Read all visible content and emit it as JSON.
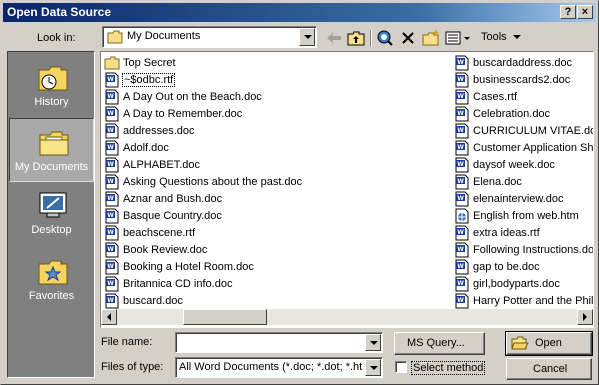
{
  "window": {
    "title": "Open Data Source",
    "help_button": "?",
    "close_button": "×"
  },
  "toolbar": {
    "look_in_label": "Look in:",
    "look_in_value": "My Documents",
    "tools_label": "Tools"
  },
  "places": [
    {
      "label": "History",
      "icon": "history-folder-icon",
      "selected": false
    },
    {
      "label": "My Documents",
      "icon": "my-documents-folder-icon",
      "selected": true
    },
    {
      "label": "Desktop",
      "icon": "desktop-icon",
      "selected": false
    },
    {
      "label": "Favorites",
      "icon": "favorites-folder-icon",
      "selected": false
    }
  ],
  "files": {
    "column1": [
      {
        "name": "Top Secret",
        "icon": "folder"
      },
      {
        "name": "~$odbc.rtf",
        "icon": "word-doc",
        "selected": true
      },
      {
        "name": "A Day Out on the Beach.doc",
        "icon": "word-doc"
      },
      {
        "name": "A Day to Remember.doc",
        "icon": "word-doc"
      },
      {
        "name": "addresses.doc",
        "icon": "word-doc"
      },
      {
        "name": "Adolf.doc",
        "icon": "word-doc"
      },
      {
        "name": "ALPHABET.doc",
        "icon": "word-doc"
      },
      {
        "name": "Asking Questions about the past.doc",
        "icon": "word-doc"
      },
      {
        "name": "Aznar and Bush.doc",
        "icon": "word-doc"
      },
      {
        "name": "Basque Country.doc",
        "icon": "word-doc"
      },
      {
        "name": "beachscene.rtf",
        "icon": "word-doc"
      },
      {
        "name": "Book Review.doc",
        "icon": "word-doc"
      },
      {
        "name": "Booking a Hotel Room.doc",
        "icon": "word-doc"
      },
      {
        "name": "Britannica CD info.doc",
        "icon": "word-doc"
      },
      {
        "name": "buscard.doc",
        "icon": "word-doc"
      }
    ],
    "column2": [
      {
        "name": "buscardaddress.doc",
        "icon": "word-doc"
      },
      {
        "name": "businesscards2.doc",
        "icon": "word-doc"
      },
      {
        "name": "Cases.rtf",
        "icon": "word-doc"
      },
      {
        "name": "Celebration.doc",
        "icon": "word-doc"
      },
      {
        "name": "CURRICULUM VITAE.doc",
        "icon": "word-doc"
      },
      {
        "name": "Customer Application Sho",
        "icon": "word-doc"
      },
      {
        "name": "daysof week.doc",
        "icon": "word-doc"
      },
      {
        "name": "Elena.doc",
        "icon": "word-doc"
      },
      {
        "name": "elenainterview.doc",
        "icon": "word-doc"
      },
      {
        "name": "English from web.htm",
        "icon": "web-doc"
      },
      {
        "name": "extra ideas.rtf",
        "icon": "word-doc"
      },
      {
        "name": "Following Instructions.do",
        "icon": "word-doc"
      },
      {
        "name": "gap to be.doc",
        "icon": "word-doc"
      },
      {
        "name": "girl,bodyparts.doc",
        "icon": "word-doc"
      },
      {
        "name": "Harry Potter and the Phil",
        "icon": "word-doc"
      }
    ]
  },
  "bottom": {
    "file_name_label": "File name:",
    "file_name_value": "",
    "files_of_type_label": "Files of type:",
    "files_of_type_value": "All Word Documents (*.doc; *.dot; *.htm",
    "ms_query_label": "MS Query...",
    "select_method_label": "Select method",
    "select_method_checked": false,
    "open_label": "Open",
    "cancel_label": "Cancel"
  }
}
